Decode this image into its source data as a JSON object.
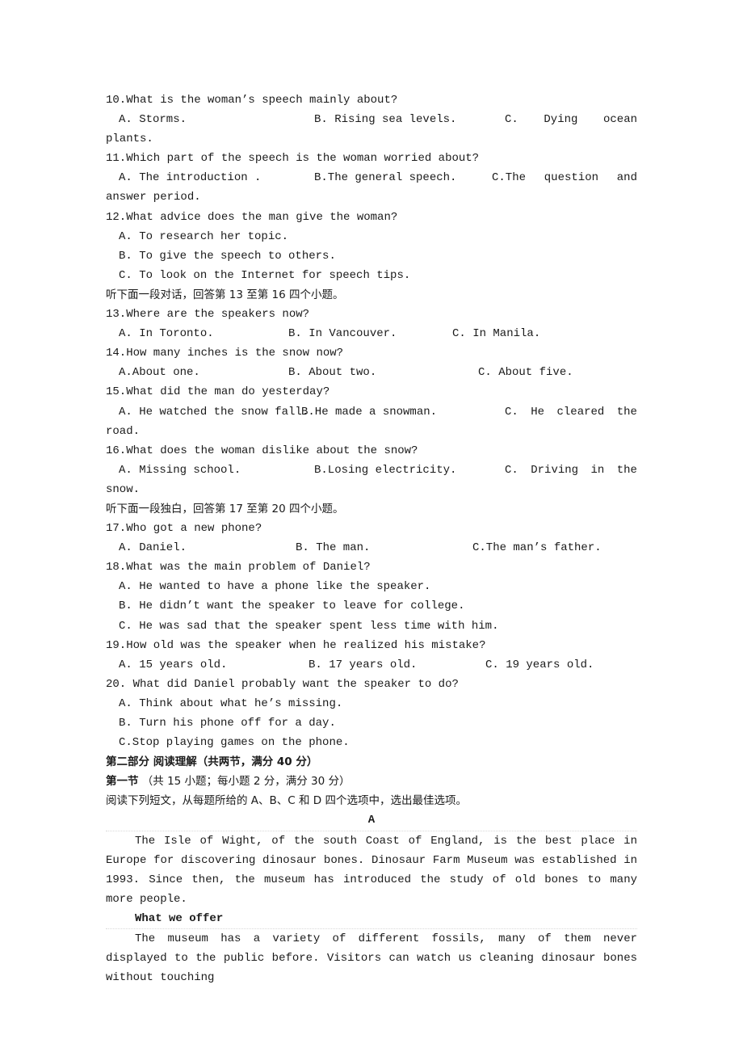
{
  "listening": {
    "q10": {
      "question": "10.What is the woman’s speech mainly about?",
      "a": "A. Storms.",
      "b": "B. Rising sea levels.",
      "c_words": [
        "C.",
        "Dying",
        "ocean"
      ],
      "c_wrap": "plants."
    },
    "q11": {
      "question": "11.Which part of the speech is the woman worried about?",
      "a": "A. The introduction .",
      "b": "B.The general speech.",
      "c_words": [
        "C.The",
        "question",
        "and"
      ],
      "c_wrap": "answer period."
    },
    "q12": {
      "question": "12.What advice does the man give the woman?",
      "a": "A. To research her topic.",
      "b": "B. To give the speech to others.",
      "c": "C. To look on the Internet for speech tips."
    },
    "instruction_13_16": "听下面一段对话，回答第 13 至第 16 四个小题。",
    "q13": {
      "question": "13.Where are the speakers now?",
      "a": "A. In Toronto.",
      "b": "B. In Vancouver.",
      "c": "C. In Manila."
    },
    "q14": {
      "question": "14.How many inches is the snow now?",
      "a": "A.About one.",
      "b": "B. About two.",
      "c": "C. About five."
    },
    "q15": {
      "question": "15.What did the man do yesterday?",
      "a": "A. He watched the snow fall.",
      "b": "B.He made a snowman.",
      "c_words": [
        "C.",
        "He",
        "cleared",
        "the"
      ],
      "c_wrap": "road."
    },
    "q16": {
      "question": "16.What does the woman dislike about the snow?",
      "a": "A. Missing school.",
      "b": "B.Losing electricity.",
      "c_words": [
        "C.",
        "Driving",
        "in",
        "the"
      ],
      "c_wrap": "snow."
    },
    "instruction_17_20": "听下面一段独白，回答第 17 至第 20 四个小题。",
    "q17": {
      "question": "17.Who got a new phone?",
      "a": "A. Daniel.",
      "b": "B. The man.",
      "c": "C.The man’s father."
    },
    "q18": {
      "question": "18.What was the main problem of Daniel?",
      "a": "A. He wanted to have a phone like the speaker.",
      "b": "B. He didn’t want the speaker to leave for college.",
      "c": "C. He was sad that the speaker spent less time with him."
    },
    "q19": {
      "question": "19.How old was the speaker when he realized his mistake?",
      "a": "A. 15 years old.",
      "b": "B. 17 years old.",
      "c": "C. 19 years old."
    },
    "q20": {
      "question": "20. What did Daniel probably want the speaker to do?",
      "a": "A. Think about what he’s missing.",
      "b": "B. Turn his phone off for a day.",
      "c": "C.Stop playing games on the phone."
    }
  },
  "reading": {
    "part_title": "第二部分 阅读理解（共两节，满分 40 分）",
    "section_title": "第一节",
    "section_note": "（共 15 小题；每小题 2 分，满分 30 分）",
    "instruction": "阅读下列短文，从每题所给的 A、B、C 和 D 四个选项中，选出最佳选项。",
    "passage_label": "A",
    "paragraph1": "The Isle of Wight, of the south Coast of England, is the best place in Europe for discovering dinosaur bones. Dinosaur Farm Museum was established in 1993. Since then, the museum has introduced the study of old bones to many more people.",
    "subheading": "What we offer",
    "paragraph2": "The museum has a variety of different fossils, many of them never displayed to the public before. Visitors can watch us cleaning dinosaur bones without touching"
  }
}
